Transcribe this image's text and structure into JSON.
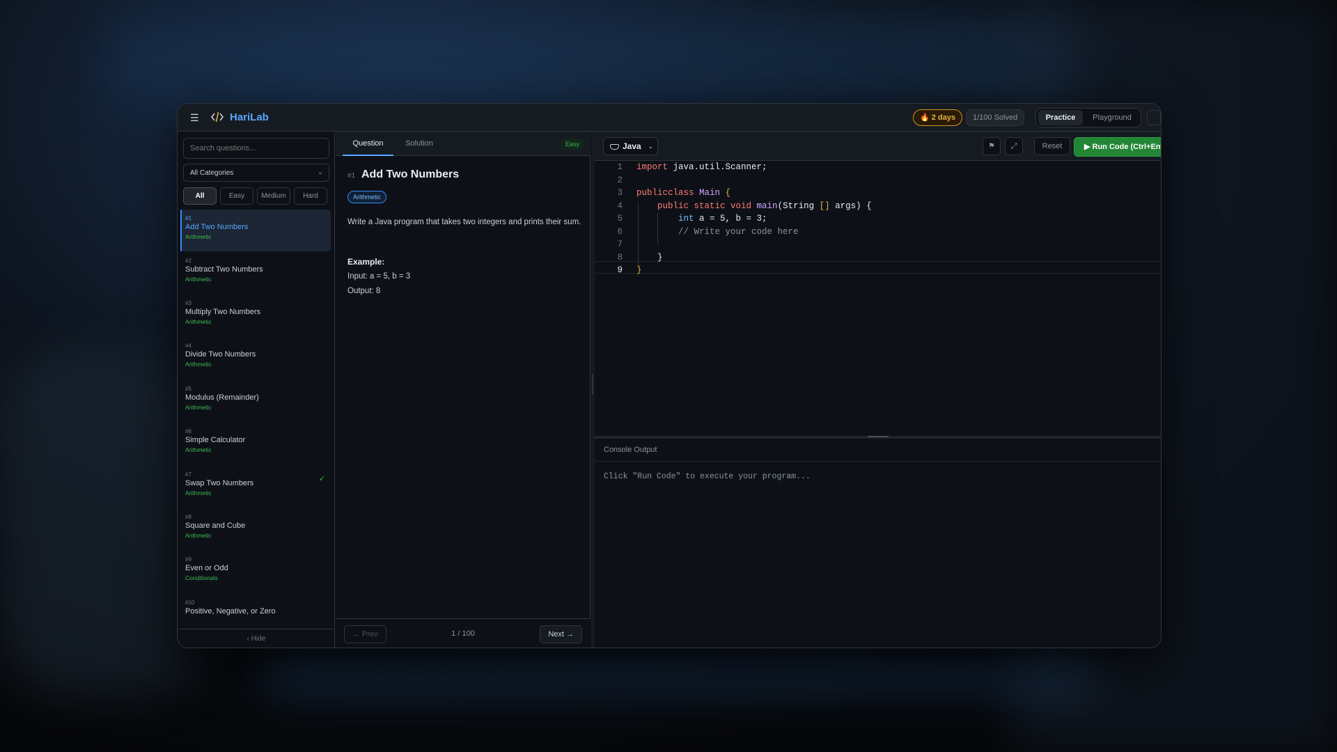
{
  "app": {
    "name": "HariLab"
  },
  "header": {
    "streak": "🔥 2 days",
    "solved": "1/100 Solved",
    "modes": [
      "Practice",
      "Playground"
    ],
    "active_mode": "Practice"
  },
  "sidebar": {
    "search_placeholder": "Search questions...",
    "category": "All Categories",
    "filters": [
      "All",
      "Easy",
      "Medium",
      "Hard"
    ],
    "active_filter": "All",
    "questions": [
      {
        "num": "#1",
        "title": "Add Two Numbers",
        "category": "Arithmetic",
        "selected": true,
        "solved": false
      },
      {
        "num": "#2",
        "title": "Subtract Two Numbers",
        "category": "Arithmetic",
        "selected": false,
        "solved": false
      },
      {
        "num": "#3",
        "title": "Multiply Two Numbers",
        "category": "Arithmetic",
        "selected": false,
        "solved": false
      },
      {
        "num": "#4",
        "title": "Divide Two Numbers",
        "category": "Arithmetic",
        "selected": false,
        "solved": false
      },
      {
        "num": "#5",
        "title": "Modulus (Remainder)",
        "category": "Arithmetic",
        "selected": false,
        "solved": false
      },
      {
        "num": "#6",
        "title": "Simple Calculator",
        "category": "Arithmetic",
        "selected": false,
        "solved": false
      },
      {
        "num": "#7",
        "title": "Swap Two Numbers",
        "category": "Arithmetic",
        "selected": false,
        "solved": true
      },
      {
        "num": "#8",
        "title": "Square and Cube",
        "category": "Arithmetic",
        "selected": false,
        "solved": false
      },
      {
        "num": "#9",
        "title": "Even or Odd",
        "category": "Conditionals",
        "selected": false,
        "solved": false
      },
      {
        "num": "#10",
        "title": "Positive, Negative, or Zero",
        "category": "",
        "selected": false,
        "solved": false
      }
    ],
    "hide_label": "‹ Hide"
  },
  "question": {
    "tabs": [
      "Question",
      "Solution"
    ],
    "active_tab": "Question",
    "difficulty": "Easy",
    "number": "#1",
    "title": "Add Two Numbers",
    "tag": "Arithmetic",
    "description": "Write a Java program that takes two integers and prints their sum.",
    "example_heading": "Example:",
    "example_input": "Input: a = 5, b = 3",
    "example_output": "Output: 8",
    "prev_label": "← Prev",
    "next_label": "Next →",
    "pagination": "1 / 100"
  },
  "editor": {
    "language": "Java",
    "reset_label": "Reset",
    "run_label": "▶ Run Code (Ctrl+Enter)",
    "current_line": 9,
    "lines": [
      [
        [
          "k",
          "import"
        ],
        [
          "",
          "java.util.Scanner;"
        ]
      ],
      [],
      [
        [
          "k",
          "public"
        ],
        [
          "",
          ""
        ],
        [
          "k",
          "class"
        ],
        [
          "f",
          "Main"
        ],
        [
          "br",
          "{"
        ]
      ],
      [
        [
          "",
          "    "
        ],
        [
          "k",
          "public static void"
        ],
        [
          "f",
          "main"
        ],
        [
          "",
          "(String"
        ],
        [
          "br",
          "[]"
        ],
        [
          "",
          "args) {"
        ]
      ],
      [
        [
          "",
          "        "
        ],
        [
          "t",
          "int"
        ],
        [
          "",
          "a = 5, b = 3;"
        ]
      ],
      [
        [
          "cm",
          "        // Write your code here"
        ]
      ],
      [],
      [
        [
          "",
          "    }"
        ]
      ],
      [
        [
          "br",
          "}"
        ]
      ]
    ]
  },
  "console": {
    "title": "Console Output",
    "output": "Click \"Run Code\" to execute your program..."
  }
}
